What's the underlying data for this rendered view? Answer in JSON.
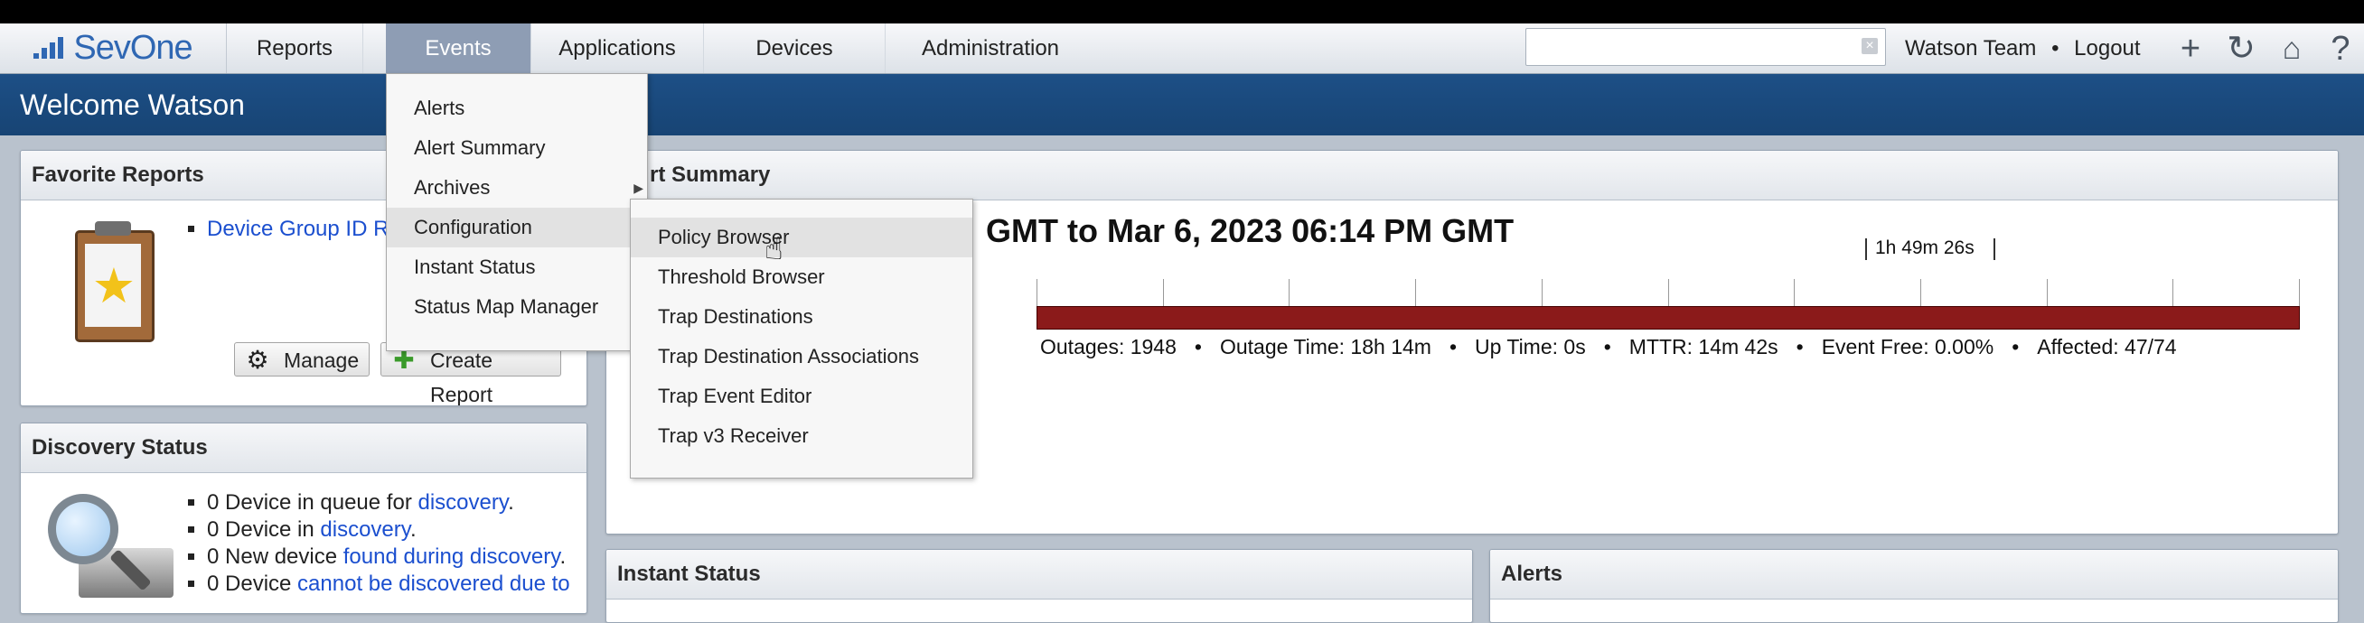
{
  "brand": {
    "name": "SevOne"
  },
  "nav": {
    "items": [
      {
        "label": "Reports"
      },
      {
        "label": "Events"
      },
      {
        "label": "Applications"
      },
      {
        "label": "Devices"
      },
      {
        "label": "Administration"
      }
    ],
    "search": {
      "value": "",
      "placeholder": ""
    },
    "user": "Watson Team",
    "separator": "•",
    "logout": "Logout",
    "icons": [
      "plus-icon",
      "refresh-icon",
      "home-icon",
      "help-icon"
    ]
  },
  "welcome": "Welcome Watson",
  "favorite_reports": {
    "title": "Favorite Reports",
    "items": [
      {
        "label": "Device Group ID Re"
      }
    ],
    "buttons": {
      "manage": "Manage",
      "create": "Create Report"
    }
  },
  "discovery": {
    "title": "Discovery Status",
    "items": [
      {
        "prefix": "0 Device in queue for ",
        "link": "discovery",
        "suffix": "."
      },
      {
        "prefix": "0 Device in ",
        "link": "discovery",
        "suffix": "."
      },
      {
        "prefix": "0 New device ",
        "link": "found during discovery",
        "suffix": "."
      },
      {
        "prefix": "0 Device ",
        "link": "cannot be discovered due to",
        "suffix": ""
      }
    ]
  },
  "alert_summary": {
    "title_fragment": "rt Summary",
    "range_text": "GMT to Mar 6, 2023 06:14 PM GMT",
    "scale_label": "1h 49m 26s",
    "stats": [
      "Outages: 1948",
      "Outage Time: 18h 14m",
      "Up Time: 0s",
      "MTTR: 14m 42s",
      "Event Free: 0.00%",
      "Affected: 47/74"
    ],
    "bar_color": "#8b1a1a",
    "tick_count": 10
  },
  "instant_status": {
    "title": "Instant Status"
  },
  "alerts": {
    "title": "Alerts"
  },
  "events_menu": {
    "items": [
      {
        "label": "Alerts"
      },
      {
        "label": "Alert Summary"
      },
      {
        "label": "Archives",
        "submenu": true
      },
      {
        "label": "Configuration",
        "highlighted": true
      },
      {
        "label": "Instant Status"
      },
      {
        "label": "Status Map Manager"
      }
    ]
  },
  "config_submenu": {
    "items": [
      {
        "label": "Policy Browser",
        "highlighted": true
      },
      {
        "label": "Threshold Browser"
      },
      {
        "label": "Trap Destinations"
      },
      {
        "label": "Trap Destination Associations"
      },
      {
        "label": "Trap Event Editor"
      },
      {
        "label": "Trap v3 Receiver"
      }
    ]
  },
  "colors": {
    "accent": "#1d4f86",
    "link": "#1b4fcf",
    "active_nav": "#8e9db4"
  }
}
